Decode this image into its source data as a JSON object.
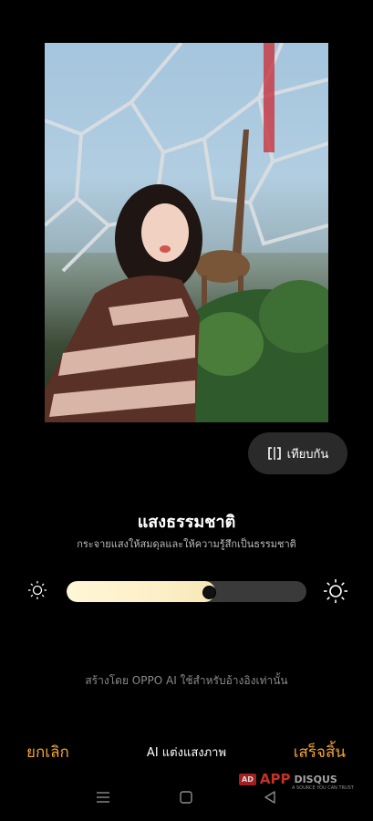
{
  "compare_button": {
    "label": "เทียบกัน",
    "icon": "compare-icon"
  },
  "effect": {
    "title": "แสงธรรมชาติ",
    "description": "กระจายแสงให้สมดุลและให้ความรู้สึกเป็นธรรมชาติ"
  },
  "slider": {
    "value_fraction": 0.62,
    "low_icon": "sun-small-icon",
    "high_icon": "sun-large-icon"
  },
  "ai_note": "สร้างโดย OPPO AI ใช้สำหรับอ้างอิงเท่านั้น",
  "bottom_bar": {
    "cancel_label": "ยกเลิก",
    "mode_label": "AI แต่งแสงภาพ",
    "done_label": "เสร็จสิ้น"
  },
  "watermark": {
    "badge": "AD",
    "brand_app": "APP",
    "brand_rest": "DISQUS",
    "tagline": "A SOURCE YOU CAN TRUST"
  },
  "colors": {
    "accent": "#f3a531",
    "background": "#000000"
  }
}
